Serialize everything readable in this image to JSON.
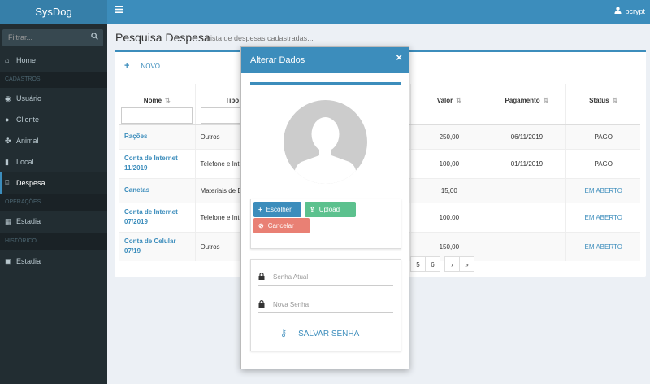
{
  "app": {
    "title": "SysDog",
    "menu_icon": "hamburger-icon"
  },
  "user": {
    "name": "bcrypt",
    "icon": "user-icon"
  },
  "sidebar": {
    "filter_placeholder": "Filtrar...",
    "items": [
      {
        "label": "Home",
        "icon": "home-icon"
      },
      {
        "section": "CADASTROS"
      },
      {
        "label": "Usuário",
        "icon": "user-circle-icon"
      },
      {
        "label": "Cliente",
        "icon": "users-icon"
      },
      {
        "label": "Animal",
        "icon": "paw-icon"
      },
      {
        "label": "Local",
        "icon": "building-icon"
      },
      {
        "label": "Despesa",
        "icon": "bank-icon",
        "active": true
      },
      {
        "section": "OPERAÇÕES"
      },
      {
        "label": "Estadia",
        "icon": "calendar-icon"
      },
      {
        "section": "HISTÓRICO"
      },
      {
        "label": "Estadia",
        "icon": "calendar-check-icon"
      }
    ]
  },
  "page": {
    "title": "Pesquisa Despesa",
    "subtitle": "Lista de despesas cadastradas..."
  },
  "toolbar": {
    "new_label": "NOVO"
  },
  "table": {
    "headers": {
      "nome": "Nome",
      "tipo": "Tipo",
      "valor": "Valor",
      "pagamento": "Pagamento",
      "status": "Status"
    },
    "rows": [
      {
        "nome": "Rações",
        "tipo": "Outros",
        "valor": "250,00",
        "pagamento": "06/11/2019",
        "status": "PAGO"
      },
      {
        "nome": "Conta de Internet 11/2019",
        "tipo": "Telefone e Inte",
        "valor": "100,00",
        "pagamento": "01/11/2019",
        "status": "PAGO"
      },
      {
        "nome": "Canetas",
        "tipo": "Materiais de Es",
        "valor": "15,00",
        "pagamento": "",
        "status": "EM ABERTO"
      },
      {
        "nome": "Conta de Internet 07/2019",
        "tipo": "Telefone e Inte",
        "valor": "100,00",
        "pagamento": "",
        "status": "EM ABERTO"
      },
      {
        "nome": "Conta de Celular 07/19",
        "tipo": "Outros",
        "valor": "150,00",
        "pagamento": "",
        "status": "EM ABERTO"
      }
    ]
  },
  "pagination": {
    "pages": [
      "5",
      "6"
    ],
    "next": "›",
    "last": "»"
  },
  "modal": {
    "title": "Alterar Dados",
    "close": "×",
    "buttons": {
      "choose": "Escolher",
      "upload": "Upload",
      "cancel": "Cancelar"
    },
    "password": {
      "current_placeholder": "Senha Atual",
      "new_placeholder": "Nova Senha",
      "save": "SALVAR SENHA"
    }
  },
  "colors": {
    "primary": "#3c8dbc",
    "success": "#5cc18e",
    "danger": "#e98074",
    "sidebar": "#222d32"
  }
}
